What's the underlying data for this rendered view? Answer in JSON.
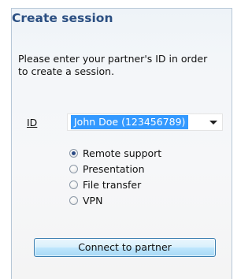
{
  "panel": {
    "title": "Create session",
    "description": "Please enter your partner's ID in order to create a session."
  },
  "id_field": {
    "label": "ID",
    "value": "John Doe (123456789)"
  },
  "modes": [
    {
      "label": "Remote support",
      "checked": true
    },
    {
      "label": "Presentation",
      "checked": false
    },
    {
      "label": "File transfer",
      "checked": false
    },
    {
      "label": "VPN",
      "checked": false
    }
  ],
  "connect_button": {
    "label": "Connect to partner"
  },
  "colors": {
    "title": "#2b4f82",
    "selection": "#3399ff",
    "button_border": "#3c7fb1"
  }
}
